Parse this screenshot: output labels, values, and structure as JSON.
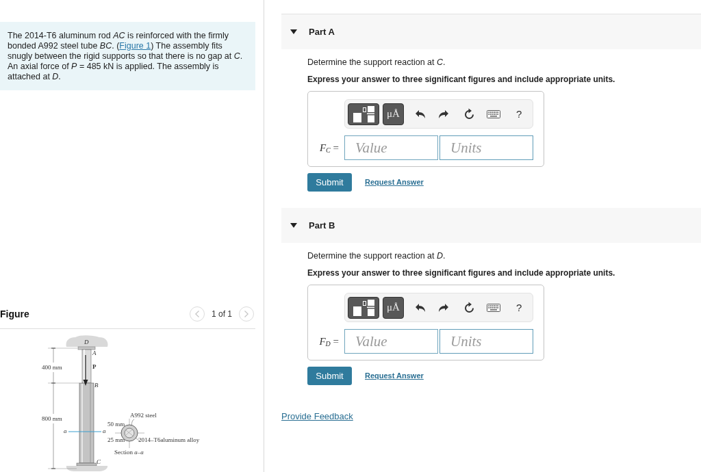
{
  "problem": {
    "text_before_link": "The 2014-T6 aluminum rod *AC* is reinforced with the firmly bonded A992 steel tube *BC*. (",
    "link": "Figure 1",
    "text_after_link": ") The assembly fits snugly between the rigid supports so that there is no gap at *C*. An axial force of *P* = 485 kN is applied. The assembly is attached at *D*."
  },
  "figure": {
    "title": "Figure",
    "page_label": "1 of 1",
    "prev_disabled": true,
    "next_disabled": true,
    "diagram": {
      "labels": {
        "point_d": "D",
        "point_a": "A",
        "load_p": "P",
        "point_b": "B",
        "point_c": "C",
        "upper_length": "400 mm",
        "lower_length": "800 mm",
        "section_mark_left": "a",
        "section_mark_right": "a",
        "tube_material": "A992 steel",
        "outer_dimension": "50 mm",
        "inner_dimension": "25 mm",
        "rod_material": "2014–T6aluminum alloy",
        "section_caption": "Section *a*–*a*"
      }
    }
  },
  "parts": [
    {
      "title": "Part A",
      "expanded": true,
      "prompt": "Determine the support reaction at *C*.",
      "instruction": "Express your answer to three significant figures and include appropriate units.",
      "toolbar": {
        "units_button": "μÅ",
        "help_button": "?"
      },
      "answer_label": "*F*$_{C}$ =",
      "value_placeholder": "Value",
      "units_placeholder": "Units",
      "submit": "Submit",
      "request_answer": "Request Answer"
    },
    {
      "title": "Part B",
      "expanded": true,
      "prompt": "Determine the support reaction at *D*.",
      "instruction": "Express your answer to three significant figures and include appropriate units.",
      "toolbar": {
        "units_button": "μÅ",
        "help_button": "?"
      },
      "answer_label": "*F*$_{D}$ =",
      "value_placeholder": "Value",
      "units_placeholder": "Units",
      "submit": "Submit",
      "request_answer": "Request Answer"
    }
  ],
  "feedback_link": "Provide Feedback"
}
